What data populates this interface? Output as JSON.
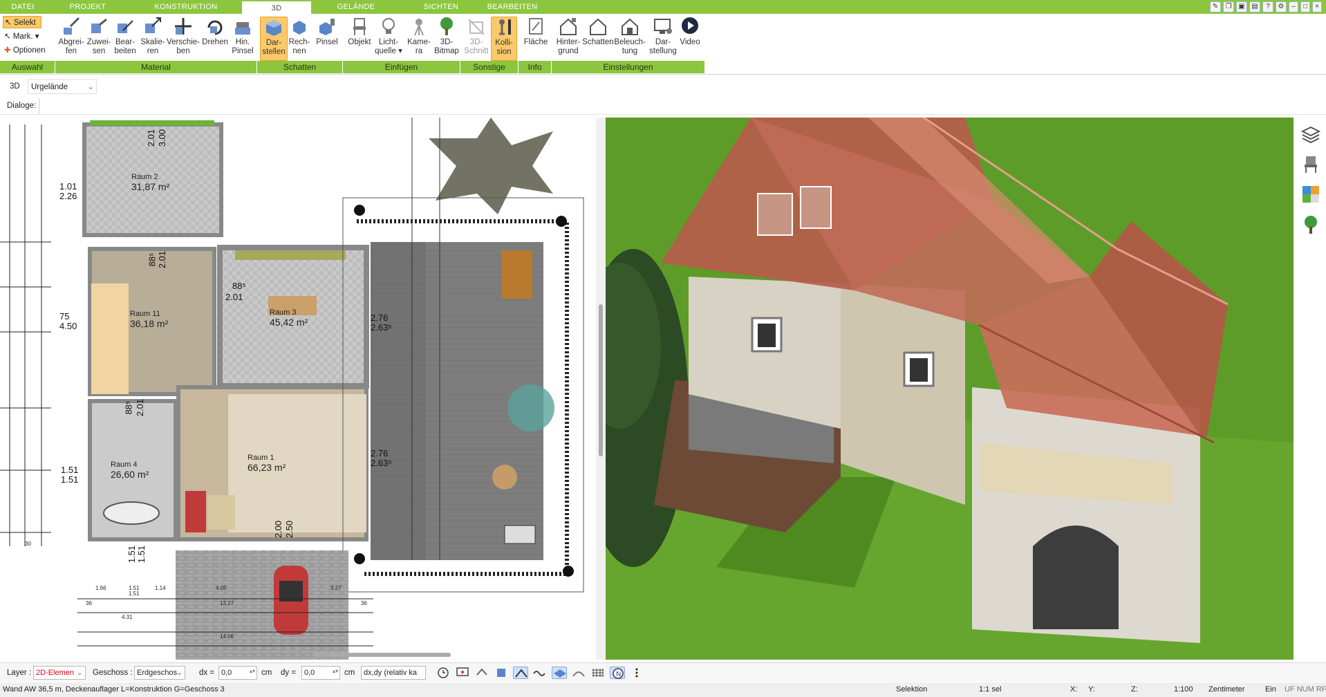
{
  "menu": {
    "tabs": [
      "DATEI",
      "PROJEKT",
      "KONSTRUKTION",
      "3D",
      "GELÄNDE",
      "SICHTEN",
      "BEARBEITEN"
    ],
    "active": "3D"
  },
  "ribbon": {
    "auswahl": {
      "selekt": "Selekt",
      "mark": "Mark.",
      "optionen": "Optionen"
    },
    "buttons": {
      "abgreifen": "Abgrei-\nfen",
      "zuweisen": "Zuwei-\nsen",
      "bearbeiten": "Bear-\nbeiten",
      "skalieren": "Skalie-\nren",
      "verschieben": "Verschie-\nben",
      "drehen": "Drehen",
      "hinpinsel": "Hin.\nPinsel",
      "darstellen": "Dar-\nstellen",
      "rechnen": "Rech-\nnen",
      "pinsel": "Pinsel",
      "objekt": "Objekt",
      "lichtquelle": "Licht-\nquelle",
      "kamera": "Kame-\nra",
      "bitmap3d": "3D-\nBitmap",
      "schnitt3d": "3D-\nSchnitt",
      "kollision": "Kolli-\nsion",
      "flaeche": "Fläche",
      "hintergrund": "Hinter-\ngrund",
      "schatten": "Schatten",
      "beleuchtung": "Beleuch-\ntung",
      "darstellung": "Dar-\nstellung",
      "video": "Video"
    },
    "groups": {
      "auswahl": "Auswahl",
      "material": "Material",
      "schatten": "Schatten",
      "einfuegen": "Einfügen",
      "sonstige": "Sonstige",
      "info": "Info",
      "einstellungen": "Einstellungen"
    }
  },
  "toolbar": {
    "mode": "3D",
    "terrain_select": "Urgelände",
    "dialoge_label": "Dialoge:"
  },
  "plan": {
    "rooms": [
      {
        "name": "Raum 2",
        "area": "31,87 m²"
      },
      {
        "name": "Raum 11",
        "area": "36,18 m²"
      },
      {
        "name": "Raum 3",
        "area": "45,42 m²"
      },
      {
        "name": "Raum 4",
        "area": "26,60 m²"
      },
      {
        "name": "Raum 1",
        "area": "66,23 m²"
      }
    ],
    "dims": {
      "d1": "2.01",
      "d2": "3.00",
      "d3": "1.01",
      "d4": "2.26",
      "d5": "88⁵",
      "d6": "2.01",
      "d7": "88⁵",
      "d8": "2.01",
      "d9": "75",
      "d10": "4.50",
      "d11": "2.76",
      "d12": "2.63⁵",
      "d13": "88⁵",
      "d14": "2.01",
      "d15": "1.51",
      "d16": "1.51",
      "d17": "2.76",
      "d18": "2.63⁵",
      "d19": "2.00",
      "d20": "2.50",
      "d21": "1.51",
      "d22": "1.51"
    },
    "small_dims": [
      "1.66",
      "1.51",
      "1.14",
      "4.05",
      "3.27",
      "13.27",
      "4.31",
      "14.06",
      "36",
      "36",
      "30",
      "1.51"
    ]
  },
  "bottom": {
    "layer_label": "Layer :",
    "layer_value": "2D-Elemen",
    "geschoss_label": "Geschoss :",
    "geschoss_value": "Erdgeschos",
    "dx_label": "dx =",
    "dx_value": "0,0",
    "dx_unit": "cm",
    "dy_label": "dy =",
    "dy_value": "0,0",
    "dy_unit": "cm",
    "mode_value": "dx,dy (relativ ka"
  },
  "status": {
    "message": "Wand AW 36,5 m, Deckenauflager L=Konstruktion G=Geschoss 3",
    "selektion": "Selektion",
    "sel": "1:1 sel",
    "x": "X:",
    "y": "Y:",
    "z": "Z:",
    "scale": "1:100",
    "unit": "Zentimeter",
    "ein": "Ein",
    "flags": "UF NUM RF"
  },
  "colors": {
    "accent_green": "#8cc63f",
    "active_orange": "#fbc96b",
    "layer_red": "#e0001a"
  }
}
